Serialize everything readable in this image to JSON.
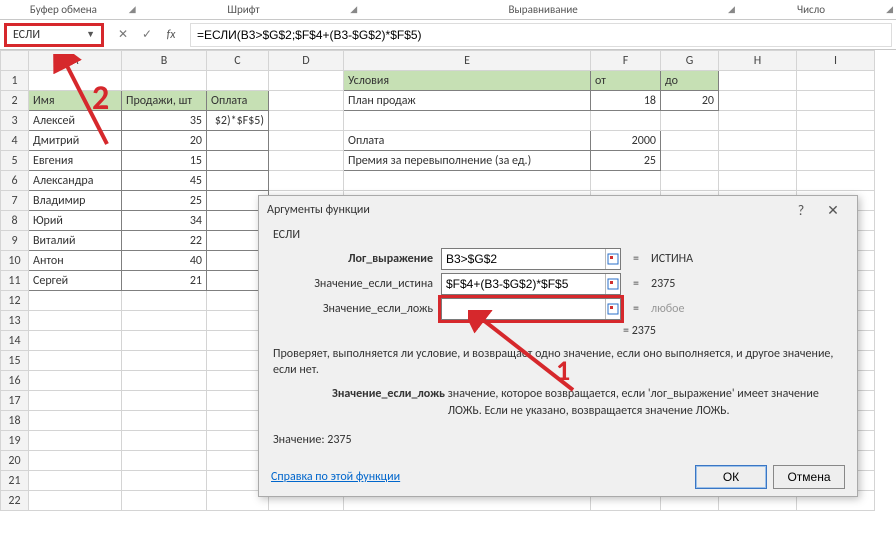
{
  "ribbon": {
    "clipboard": "Буфер обмена",
    "font": "Шрифт",
    "align": "Выравнивание",
    "number": "Число"
  },
  "namebox": "ЕСЛИ",
  "formula": "=ЕСЛИ(B3>$G$2;$F$4+(B3-$G$2)*$F$5)",
  "columns": [
    "A",
    "B",
    "C",
    "D",
    "E",
    "F",
    "G",
    "H",
    "I"
  ],
  "left_table": {
    "headers": [
      "Имя",
      "Продажи, шт",
      "Оплата"
    ],
    "c3_value": "$2)*$F$5)",
    "rows": [
      [
        "Алексей",
        "35"
      ],
      [
        "Дмитрий",
        "20"
      ],
      [
        "Евгения",
        "15"
      ],
      [
        "Александра",
        "45"
      ],
      [
        "Владимир",
        "25"
      ],
      [
        "Юрий",
        "34"
      ],
      [
        "Виталий",
        "22"
      ],
      [
        "Антон",
        "40"
      ],
      [
        "Сергей",
        "21"
      ]
    ]
  },
  "right_table": {
    "r1": {
      "label": "Условия",
      "f": "от",
      "g": "до"
    },
    "r2": {
      "label": "План продаж",
      "f": "18",
      "g": "20"
    },
    "r4": {
      "label": "Оплата",
      "f": "2000"
    },
    "r5": {
      "label": "Премия за перевыполнение (за ед.)",
      "f": "25"
    }
  },
  "dialog": {
    "title": "Аргументы функции",
    "fn": "ЕСЛИ",
    "arg1": {
      "label": "Лог_выражение",
      "value": "B3>$G$2",
      "result": "ИСТИНА"
    },
    "arg2": {
      "label": "Значение_если_истина",
      "value": "$F$4+(B3-$G$2)*$F$5",
      "result": "2375"
    },
    "arg3": {
      "label": "Значение_если_ложь",
      "value": "",
      "result": "любое"
    },
    "overall_eq": "=  2375",
    "desc_main": "Проверяет, выполняется ли условие, и возвращает одно значение, если оно выполняется, и другое значение, если нет.",
    "desc_arg_label": "Значение_если_ложь",
    "desc_arg_text": "значение, которое возвращается, если 'лог_выражение' имеет значение ЛОЖЬ. Если не указано, возвращается значение ЛОЖЬ.",
    "value_label": "Значение:",
    "value": "2375",
    "help_link": "Справка по этой функции",
    "ok": "ОК",
    "cancel": "Отмена"
  },
  "ann": {
    "one": "1",
    "two": "2"
  }
}
